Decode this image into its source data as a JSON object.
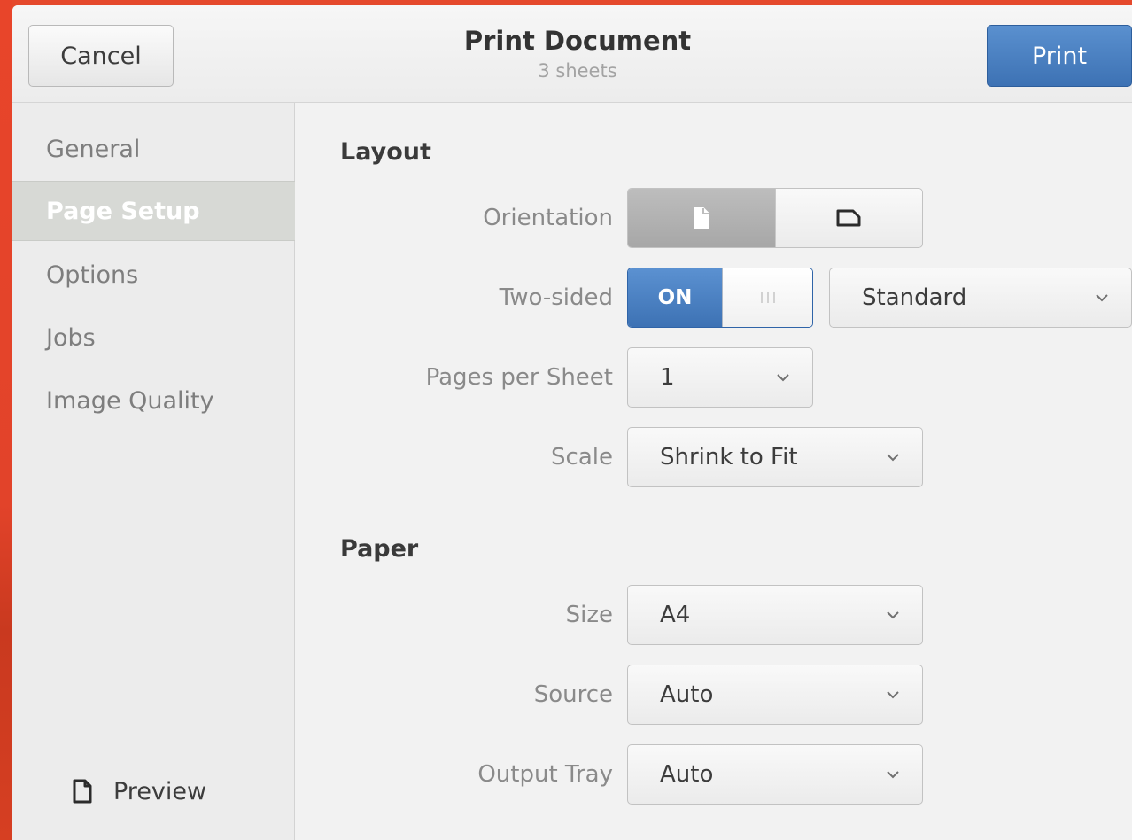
{
  "header": {
    "cancel_label": "Cancel",
    "print_label": "Print",
    "title": "Print Document",
    "subtitle": "3 sheets"
  },
  "sidebar": {
    "items": [
      {
        "label": "General",
        "active": false
      },
      {
        "label": "Page Setup",
        "active": true
      },
      {
        "label": "Options",
        "active": false
      },
      {
        "label": "Jobs",
        "active": false
      },
      {
        "label": "Image Quality",
        "active": false
      }
    ],
    "preview_label": "Preview",
    "preview_icon": "document-icon"
  },
  "layout": {
    "section_title": "Layout",
    "orientation": {
      "label": "Orientation",
      "options": [
        "portrait-icon",
        "landscape-icon"
      ],
      "selected": "portrait"
    },
    "two_sided": {
      "label": "Two-sided",
      "switch_label": "ON",
      "state": "on",
      "mode_value": "Standard"
    },
    "pages_per_sheet": {
      "label": "Pages per Sheet",
      "value": "1"
    },
    "scale": {
      "label": "Scale",
      "value": "Shrink to Fit"
    }
  },
  "paper": {
    "section_title": "Paper",
    "size": {
      "label": "Size",
      "value": "A4"
    },
    "source": {
      "label": "Source",
      "value": "Auto"
    },
    "output_tray": {
      "label": "Output Tray",
      "value": "Auto"
    }
  },
  "colors": {
    "accent": "#3d72b4",
    "desktop_background": "#e5492c",
    "dialog_background": "#f2f2f2"
  }
}
